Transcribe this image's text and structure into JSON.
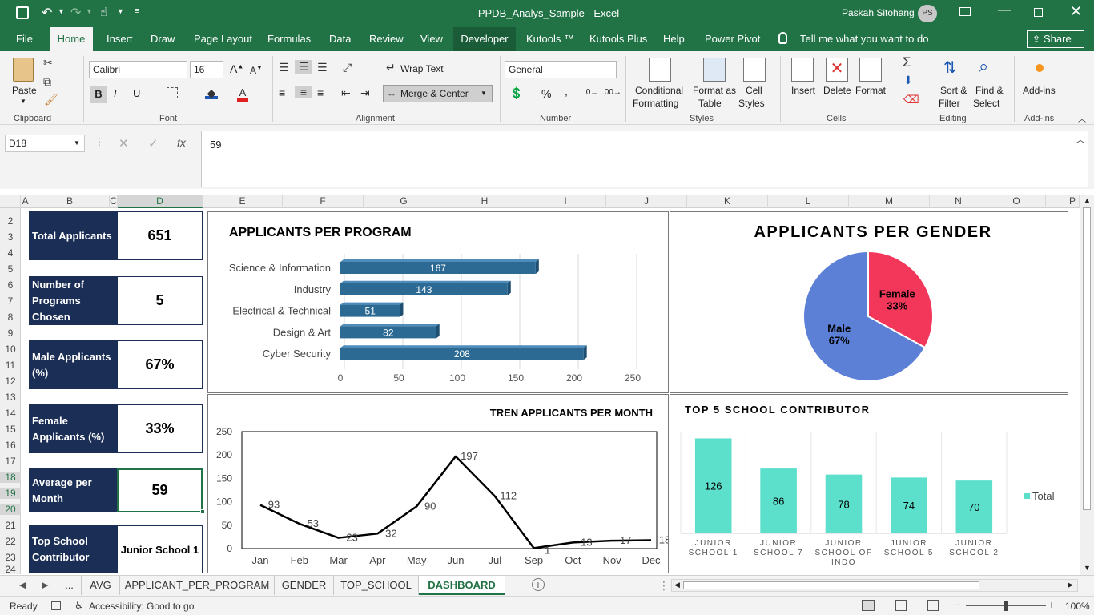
{
  "window": {
    "title": "PPDB_Analys_Sample  -  Excel",
    "user": "Paskah Sitohang",
    "initials": "PS"
  },
  "menu": [
    "File",
    "Home",
    "Insert",
    "Draw",
    "Page Layout",
    "Formulas",
    "Data",
    "Review",
    "View",
    "Developer",
    "Kutools ™",
    "Kutools Plus",
    "Help",
    "Power Pivot"
  ],
  "tell_me": "Tell me what you want to do",
  "share": "Share",
  "ribbon": {
    "paste": "Paste",
    "clipboard": "Clipboard",
    "font_name": "Calibri",
    "font_size": "16",
    "font_group": "Font",
    "bold": "B",
    "italic": "I",
    "underline": "U",
    "wrap": "Wrap Text",
    "merge": "Merge & Center",
    "alignment": "Alignment",
    "number_format": "General",
    "number": "Number",
    "percent": "%",
    "comma": ",",
    "cond1": "Conditional",
    "cond2": "Formatting",
    "fmt1": "Format as",
    "fmt2": "Table",
    "cell1": "Cell",
    "cell2": "Styles",
    "styles": "Styles",
    "insert": "Insert",
    "delete": "Delete",
    "format": "Format",
    "cells": "Cells",
    "sort1": "Sort &",
    "sort2": "Filter",
    "find1": "Find &",
    "find2": "Select",
    "editing": "Editing",
    "addins": "Add-ins",
    "addins_group": "Add-ins"
  },
  "formula": {
    "name_box": "D18",
    "value": "59",
    "fx": "fx"
  },
  "columns": [
    "A",
    "B",
    "C",
    "D",
    "E",
    "F",
    "G",
    "H",
    "I",
    "J",
    "K",
    "L",
    "M",
    "N",
    "O",
    "P"
  ],
  "rows": [
    "2",
    "3",
    "4",
    "5",
    "6",
    "7",
    "8",
    "9",
    "10",
    "11",
    "12",
    "13",
    "14",
    "15",
    "16",
    "17",
    "18",
    "19",
    "20",
    "21",
    "22",
    "23",
    "24"
  ],
  "kpis": [
    {
      "label": "Total Applicants",
      "value": "651"
    },
    {
      "label": "Number of Programs Chosen",
      "value": "5"
    },
    {
      "label": "Male Applicants (%)",
      "value": "67%"
    },
    {
      "label": "Female Applicants (%)",
      "value": "33%"
    },
    {
      "label": "Average per Month",
      "value": "59"
    },
    {
      "label": "Top School Contributor",
      "value": "Junior School 1"
    }
  ],
  "chart_data": [
    {
      "type": "bar",
      "title": "APPLICANTS PER PROGRAM",
      "categories": [
        "Science & Information",
        "Industry",
        "Electrical & Technical",
        "Design & Art",
        "Cyber Security"
      ],
      "values": [
        167,
        143,
        51,
        82,
        208
      ],
      "xlim": [
        0,
        250
      ],
      "ticks": [
        0,
        50,
        100,
        150,
        200,
        250
      ],
      "color": "#2c6a94",
      "grid": true
    },
    {
      "type": "pie",
      "title": "APPLICANTS PER GENDER",
      "slices": [
        {
          "name": "Female",
          "value": 33,
          "label": "33%",
          "color": "#f2375a"
        },
        {
          "name": "Male",
          "value": 67,
          "label": "67%",
          "color": "#5b80d6"
        }
      ]
    },
    {
      "type": "line",
      "title": "TREN APPLICANTS PER MONTH",
      "categories": [
        "Jan",
        "Feb",
        "Mar",
        "Apr",
        "May",
        "Jun",
        "Jul",
        "Sep",
        "Oct",
        "Nov",
        "Dec"
      ],
      "values": [
        93,
        53,
        23,
        32,
        90,
        197,
        112,
        1,
        13,
        17,
        18
      ],
      "ylim": [
        0,
        250
      ],
      "ticks": [
        0,
        50,
        100,
        150,
        200,
        250
      ],
      "color": "#000000"
    },
    {
      "type": "bar",
      "title": "TOP 5 SCHOOL CONTRIBUTOR",
      "categories": [
        [
          "JUNIOR",
          "SCHOOL 1"
        ],
        [
          "JUNIOR",
          "SCHOOL 7"
        ],
        [
          "JUNIOR",
          "SCHOOL OF",
          "INDO"
        ],
        [
          "JUNIOR",
          "SCHOOL 5"
        ],
        [
          "JUNIOR",
          "SCHOOL 2"
        ]
      ],
      "values": [
        126,
        86,
        78,
        74,
        70
      ],
      "legend": "Total",
      "legend_position": "right",
      "color": "#5cdfcb"
    }
  ],
  "sheets": [
    "...",
    "AVG",
    "APPLICANT_PER_PROGRAM",
    "GENDER",
    "TOP_SCHOOL",
    "DASHBOARD"
  ],
  "active_sheet": "DASHBOARD",
  "status": {
    "ready": "Ready",
    "accessibility": "Accessibility: Good to go",
    "zoom": "100%"
  }
}
